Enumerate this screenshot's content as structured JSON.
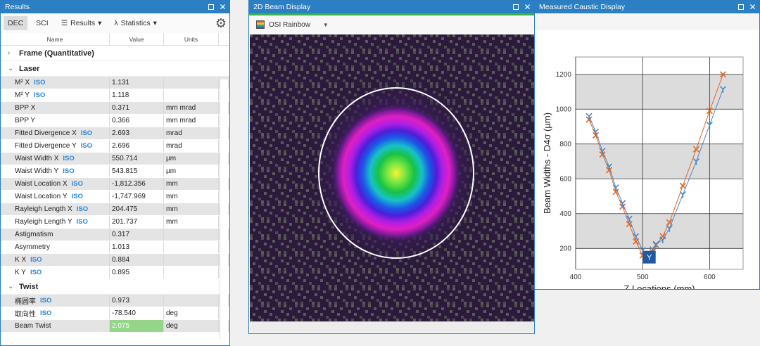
{
  "results_panel": {
    "title": "Results",
    "toolbar": {
      "dec_label": "DEC",
      "sci_label": "SCI",
      "results_label": "Results",
      "statistics_label": "Statistics"
    },
    "columns": {
      "name": "Name",
      "value": "Value",
      "units": "Units"
    },
    "groups": {
      "frame": "Frame (Quantitative)",
      "laser": "Laser",
      "twist": "Twist"
    },
    "iso_label": "ISO",
    "laser_rows": [
      {
        "name": "M² X",
        "value": "1.131",
        "units": ""
      },
      {
        "name": "M² Y",
        "value": "1.118",
        "units": ""
      },
      {
        "name": "BPP X",
        "value": "0.371",
        "units": "mm mrad"
      },
      {
        "name": "BPP Y",
        "value": "0.366",
        "units": "mm mrad"
      },
      {
        "name": "Fitted Divergence X",
        "value": "2.693",
        "units": "mrad"
      },
      {
        "name": "Fitted Divergence Y",
        "value": "2.696",
        "units": "mrad"
      },
      {
        "name": "Waist Width X",
        "value": "550.714",
        "units": "µm"
      },
      {
        "name": "Waist Width Y",
        "value": "543.815",
        "units": "µm"
      },
      {
        "name": "Waist Location X",
        "value": "-1,812.356",
        "units": "mm"
      },
      {
        "name": "Waist Location Y",
        "value": "-1,747.969",
        "units": "mm"
      },
      {
        "name": "Rayleigh Length X",
        "value": "204.475",
        "units": "mm"
      },
      {
        "name": "Rayleigh Length Y",
        "value": "201.737",
        "units": "mm"
      },
      {
        "name": "Astigmatism",
        "value": "0.317",
        "units": ""
      },
      {
        "name": "Asymmetry",
        "value": "1.013",
        "units": ""
      },
      {
        "name": "K X",
        "value": "0.884",
        "units": ""
      },
      {
        "name": "K Y",
        "value": "0.895",
        "units": ""
      }
    ],
    "twist_rows": [
      {
        "name": "椭圆率",
        "value": "0.973",
        "units": ""
      },
      {
        "name": "取向性",
        "value": "-78.540",
        "units": "deg"
      },
      {
        "name": "Beam Twist",
        "value": "2.075",
        "units": "deg"
      }
    ],
    "highlight_color": "#94d58a",
    "accent_color": "#2b7fc3"
  },
  "beam_panel": {
    "title": "2D Beam Display",
    "palette_label": "OSI Rainbow",
    "palette_icon": "rainbow-palette-icon"
  },
  "caustic_panel": {
    "title": "Measured Caustic Display"
  },
  "chart_data": {
    "type": "line",
    "title": "",
    "xlabel": "Z Locations (mm)",
    "ylabel": "Beam Widths - D4σ (µm)",
    "xlim": [
      400,
      650
    ],
    "ylim": [
      80,
      1300
    ],
    "xticks": [
      400,
      500,
      600
    ],
    "yticks": [
      200,
      400,
      600,
      800,
      1000,
      1200
    ],
    "grid": true,
    "marker_label": "Y",
    "series": [
      {
        "color": "#e8651f",
        "marker": "x",
        "x": [
          420,
          430,
          440,
          450,
          460,
          470,
          480,
          490,
          500,
          510,
          515,
          520,
          530,
          540,
          560,
          580,
          600,
          620
        ],
        "y": [
          940,
          850,
          740,
          650,
          525,
          440,
          340,
          240,
          160,
          145,
          180,
          220,
          270,
          350,
          560,
          770,
          990,
          1200
        ]
      },
      {
        "color": "#4a86c5",
        "marker": "y",
        "x": [
          420,
          430,
          440,
          450,
          460,
          470,
          480,
          490,
          500,
          510,
          515,
          520,
          530,
          540,
          560,
          580,
          600,
          620
        ],
        "y": [
          960,
          870,
          760,
          670,
          550,
          460,
          370,
          270,
          190,
          160,
          195,
          225,
          250,
          315,
          510,
          700,
          910,
          1115
        ]
      }
    ]
  }
}
